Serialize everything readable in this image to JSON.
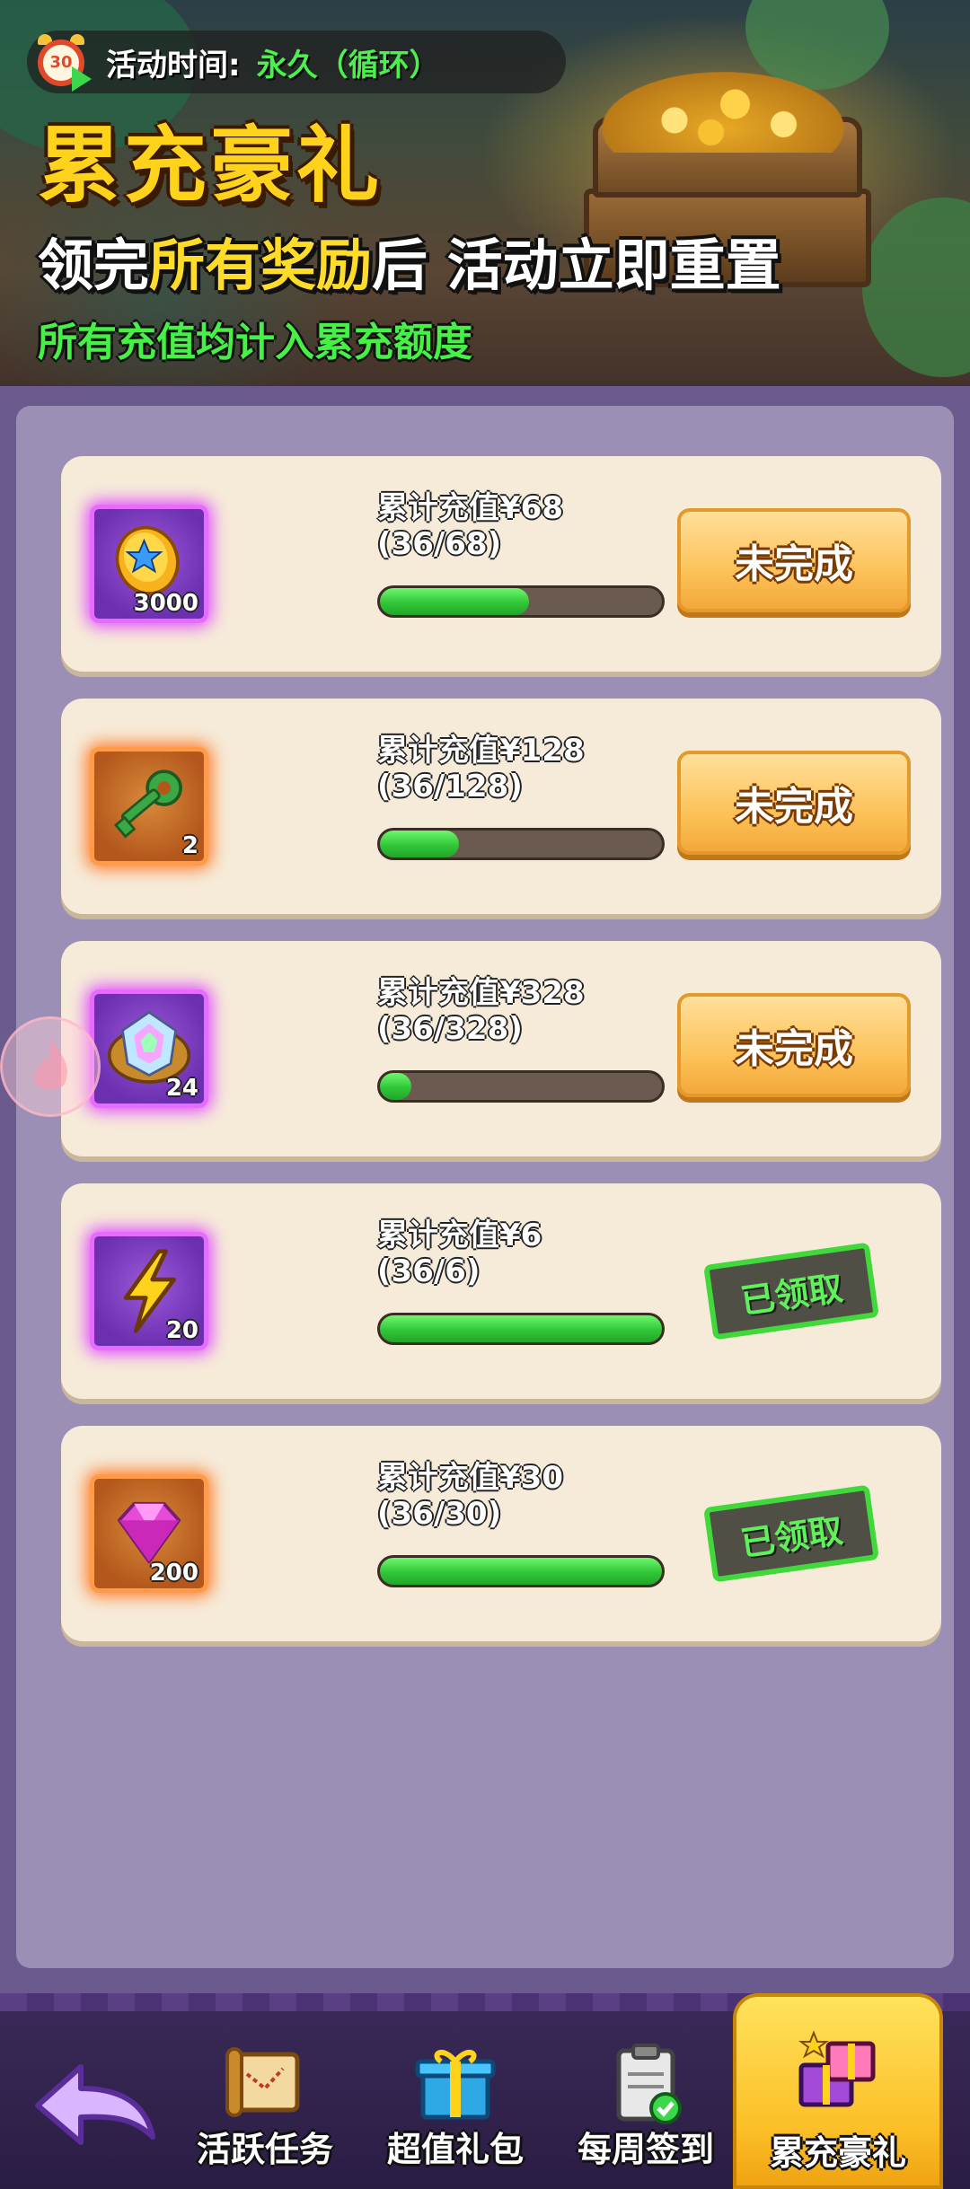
{
  "header": {
    "event_time_label": "活动时间:",
    "event_time_value": "永久（循环）",
    "clock_badge": "30",
    "title": "累充豪礼",
    "subtitle_part1": "领完",
    "subtitle_part2": "所有奖励",
    "subtitle_part3": "后 活动立即重置",
    "note": "所有充值均计入累充额度"
  },
  "rewards": [
    {
      "item_icon": "gold-coin-icon",
      "count": "3000",
      "frame": "purple",
      "label": "累计充值¥68",
      "progress_text": "(36/68)",
      "progress": 0.53,
      "status": "未完成"
    },
    {
      "item_icon": "green-key-icon",
      "count": "2",
      "frame": "orange",
      "label": "累计充值¥128",
      "progress_text": "(36/128)",
      "progress": 0.28,
      "status": "未完成"
    },
    {
      "item_icon": "rainbow-gem-icon",
      "count": "24",
      "frame": "purple",
      "label": "累计充值¥328",
      "progress_text": "(36/328)",
      "progress": 0.11,
      "status": "未完成"
    },
    {
      "item_icon": "lightning-icon",
      "count": "20",
      "frame": "purple",
      "label": "累计充值¥6",
      "progress_text": "(36/6)",
      "progress": 1.0,
      "status": "已领取"
    },
    {
      "item_icon": "pink-diamond-icon",
      "count": "200",
      "frame": "orange",
      "label": "累计充值¥30",
      "progress_text": "(36/30)",
      "progress": 1.0,
      "status": "已领取"
    }
  ],
  "bottom_nav": {
    "back_icon": "back-arrow-icon",
    "tabs": [
      {
        "label": "活跃任务",
        "icon": "scroll-map-icon"
      },
      {
        "label": "超值礼包",
        "icon": "gift-box-icon"
      },
      {
        "label": "每周签到",
        "icon": "clipboard-check-icon"
      },
      {
        "label": "累充豪礼",
        "icon": "gift-stack-icon",
        "active": true
      }
    ]
  },
  "colors": {
    "accent_yellow": "#ffd21c",
    "accent_green": "#47f047",
    "panel_bg": "#9b8fb6",
    "card_bg": "#f6ebd9"
  }
}
